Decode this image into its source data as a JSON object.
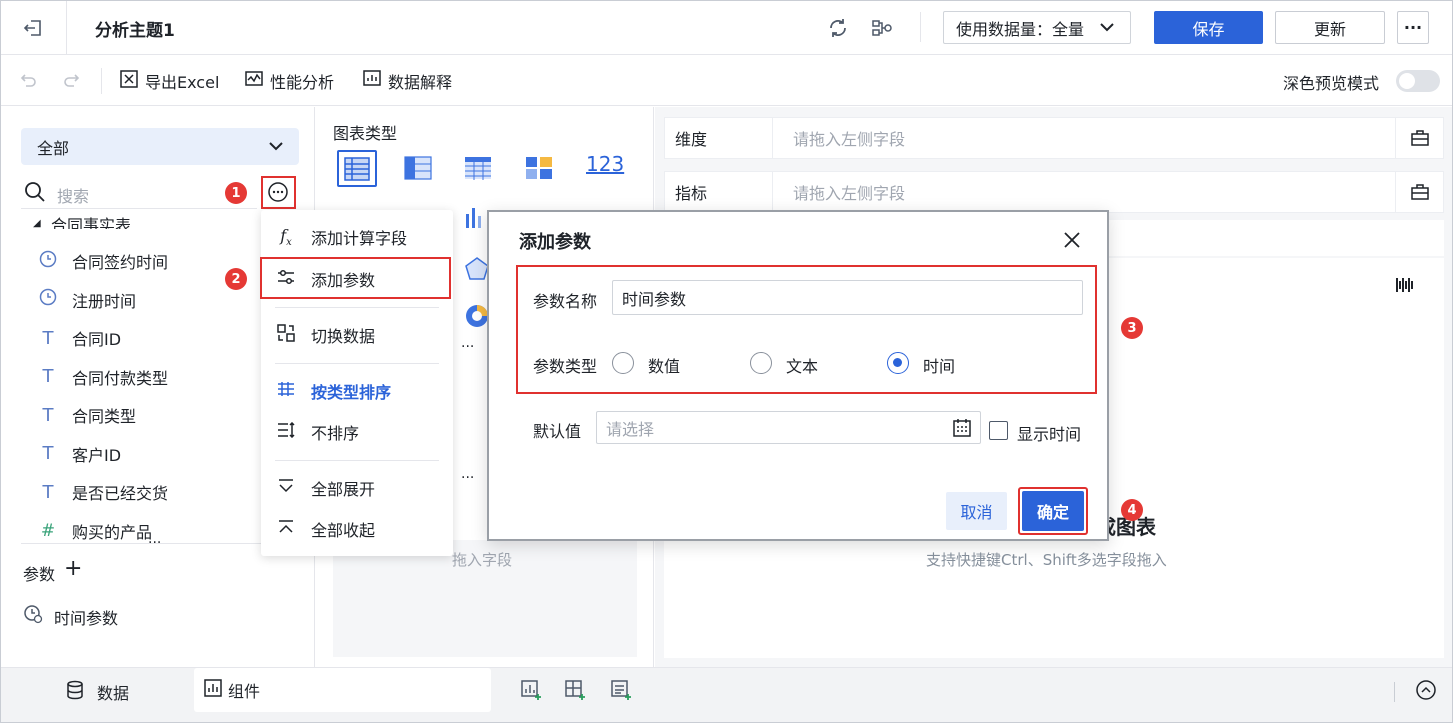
{
  "topbar": {
    "title": "分析主题1",
    "data_amount": "使用数据量：全量",
    "save": "保存",
    "update": "更新",
    "more": "···"
  },
  "toolbar": {
    "export": "导出Excel",
    "perf": "性能分析",
    "explain": "数据解释",
    "dark_mode": "深色预览模式"
  },
  "left": {
    "select": "全部",
    "search_placeholder": "搜索",
    "table": "合同事实表",
    "fields": [
      {
        "icon": "clock-icon",
        "label": "合同签约时间"
      },
      {
        "icon": "clock-icon",
        "label": "注册时间"
      },
      {
        "icon": "text-icon",
        "label": "合同ID"
      },
      {
        "icon": "text-icon",
        "label": "合同付款类型"
      },
      {
        "icon": "text-icon",
        "label": "合同类型"
      },
      {
        "icon": "text-icon",
        "label": "客户ID"
      },
      {
        "icon": "text-icon",
        "label": "是否已经交货"
      },
      {
        "icon": "hash-icon",
        "label": "购买的产品"
      }
    ],
    "params_label": "参数",
    "param_item": "时间参数"
  },
  "menu": {
    "calc": "添加计算字段",
    "param": "添加参数",
    "switch": "切换数据",
    "sort_type": "按类型排序",
    "no_sort": "不排序",
    "expand": "全部展开",
    "collapse": "全部收起"
  },
  "mid": {
    "chart_type": "图表类型",
    "drop_hint": "拖入字段",
    "dots": "···"
  },
  "right": {
    "dim": "维度",
    "metric": "指标",
    "drop_left": "请拖入左侧字段",
    "chart_partial": "成图表",
    "hint": "支持快捷键Ctrl、Shift多选字段拖入"
  },
  "dialog": {
    "title": "添加参数",
    "name_label": "参数名称",
    "name_value": "时间参数",
    "type_label": "参数类型",
    "types": [
      "数值",
      "文本",
      "时间"
    ],
    "selected_type": "时间",
    "default_label": "默认值",
    "default_placeholder": "请选择",
    "show_time": "显示时间",
    "cancel": "取消",
    "ok": "确定"
  },
  "badges": [
    "1",
    "2",
    "3",
    "4"
  ],
  "bottom": {
    "data_tab": "数据",
    "widget_tab": "组件"
  },
  "colors": {
    "primary": "#2b63d9",
    "badge": "#e53935",
    "highlight": "#e0312f"
  }
}
